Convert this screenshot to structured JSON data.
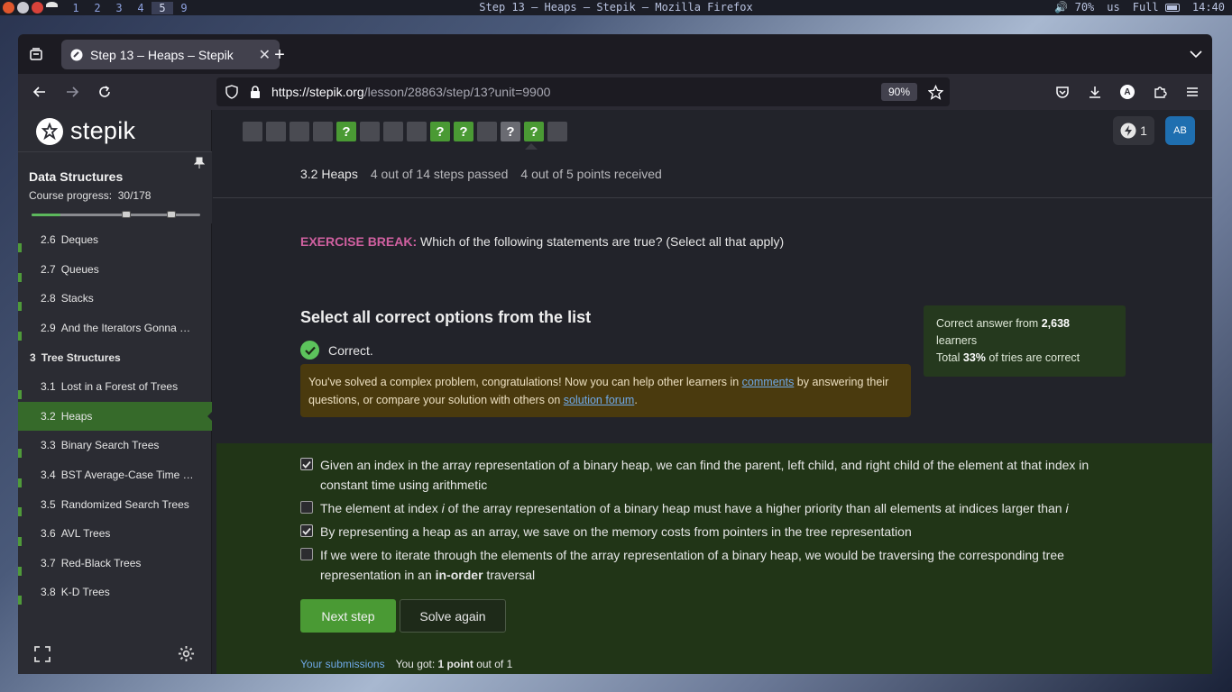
{
  "system": {
    "workspaces": [
      "1",
      "2",
      "3",
      "4",
      "5",
      "9"
    ],
    "active_workspace": "5",
    "window_title": "Step 13 – Heaps – Stepik — Mozilla Firefox",
    "volume": "70%",
    "layout": "us",
    "battery": "Full",
    "time": "14:40"
  },
  "browser": {
    "tab_title": "Step 13 – Heaps – Stepik",
    "url_host": "https://stepik.org",
    "url_path": "/lesson/28863/step/13?unit=9900",
    "zoom": "90%",
    "account_initial": "A"
  },
  "sidebar": {
    "logo": "stepik",
    "course_title": "Data Structures",
    "course_progress_label": "Course progress:",
    "course_progress_value": "30/178",
    "progress_fraction": 0.169,
    "items": [
      {
        "num": "2.6",
        "label": "Deques",
        "type": "lesson"
      },
      {
        "num": "2.7",
        "label": "Queues",
        "type": "lesson"
      },
      {
        "num": "2.8",
        "label": "Stacks",
        "type": "lesson"
      },
      {
        "num": "2.9",
        "label": "And the Iterators Gonna …",
        "type": "lesson"
      },
      {
        "num": "3",
        "label": "Tree Structures",
        "type": "module"
      },
      {
        "num": "3.1",
        "label": "Lost in a Forest of Trees",
        "type": "lesson"
      },
      {
        "num": "3.2",
        "label": "Heaps",
        "type": "lesson",
        "active": true
      },
      {
        "num": "3.3",
        "label": "Binary Search Trees",
        "type": "lesson"
      },
      {
        "num": "3.4",
        "label": "BST Average-Case Time …",
        "type": "lesson"
      },
      {
        "num": "3.5",
        "label": "Randomized Search Trees",
        "type": "lesson"
      },
      {
        "num": "3.6",
        "label": "AVL Trees",
        "type": "lesson"
      },
      {
        "num": "3.7",
        "label": "Red-Black Trees",
        "type": "lesson"
      },
      {
        "num": "3.8",
        "label": "K-D Trees",
        "type": "lesson"
      }
    ]
  },
  "steps": [
    {
      "state": "plain"
    },
    {
      "state": "plain"
    },
    {
      "state": "plain"
    },
    {
      "state": "plain"
    },
    {
      "state": "quiz-passed"
    },
    {
      "state": "plain"
    },
    {
      "state": "plain"
    },
    {
      "state": "plain"
    },
    {
      "state": "quiz-passed"
    },
    {
      "state": "quiz-passed"
    },
    {
      "state": "plain"
    },
    {
      "state": "quiz"
    },
    {
      "state": "quiz-passed",
      "current": true
    },
    {
      "state": "plain"
    }
  ],
  "steps_question_mark": "?",
  "header": {
    "energy": "1",
    "avatar": "AB",
    "lesson_name": "3.2 Heaps",
    "steps_passed": "4 out of 14 steps passed",
    "points": "4 out of 5 points  received"
  },
  "exercise": {
    "tag": "EXERCISE BREAK:",
    "text": " Which of the following statements are true? (Select all that apply)"
  },
  "quiz": {
    "title": "Select all correct options from the list",
    "status": "Correct.",
    "congrats_1": "You've solved a complex problem, congratulations! Now you can help other learners in ",
    "comments_link": "comments",
    "congrats_2": " by answering their questions, or compare your solution with others on ",
    "forum_link": "solution forum",
    "congrats_3": ".",
    "stats_prefix": "Correct answer from ",
    "stats_count": "2,638",
    "stats_learners": " learners",
    "stats_total_prefix": "Total ",
    "stats_percent": "33%",
    "stats_total_suffix": " of tries are correct",
    "options": [
      {
        "checked": true,
        "text": "Given an index in the array representation of a binary heap, we can find the parent, left child, and right child of the element at that index in constant time using arithmetic"
      },
      {
        "checked": false,
        "text_a": "The element at index ",
        "em1": "i",
        "text_b": " of the array representation of a binary heap must have a higher priority than all elements at indices larger than ",
        "em2": "i"
      },
      {
        "checked": true,
        "text": "By representing a heap as an array, we save on the memory costs from pointers in the tree representation"
      },
      {
        "checked": false,
        "text_a": "If we were to iterate through the elements of the array representation of a binary heap, we would be traversing the corresponding tree representation in an ",
        "bold": "in-order",
        "text_b": " traversal"
      }
    ],
    "next_button": "Next step",
    "again_button": "Solve again",
    "submissions_link": "Your submissions",
    "got_prefix": "You got: ",
    "got_points": "1 point",
    "got_suffix": " out of 1"
  }
}
